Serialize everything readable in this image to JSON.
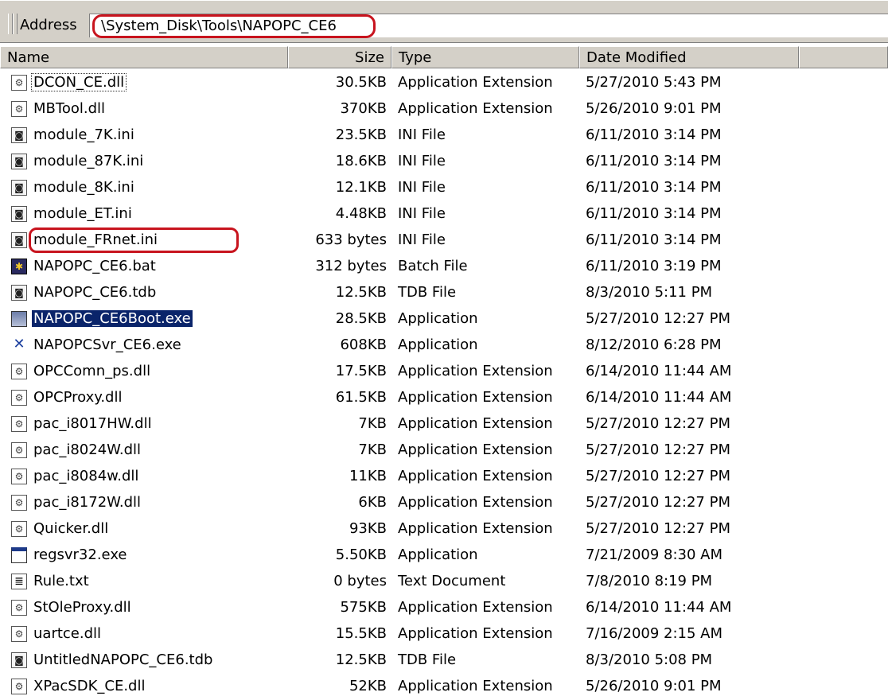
{
  "address_bar": {
    "label": "Address",
    "path": "\\System_Disk\\Tools\\NAPOPC_CE6"
  },
  "columns": {
    "name": "Name",
    "size": "Size",
    "type": "Type",
    "date": "Date Modified"
  },
  "colors": {
    "highlight_oval": "#c8141e",
    "selection": "#0a246a"
  },
  "files": [
    {
      "icon": "dll-file-icon",
      "name": "DCON_CE.dll",
      "size": "30.5KB",
      "type": "Application Extension",
      "date": "5/27/2010 5:43 PM"
    },
    {
      "icon": "dll-file-icon",
      "name": "MBTool.dll",
      "size": "370KB",
      "type": "Application Extension",
      "date": "5/26/2010 9:01 PM"
    },
    {
      "icon": "ini-file-icon",
      "name": "module_7K.ini",
      "size": "23.5KB",
      "type": "INI File",
      "date": "6/11/2010 3:14 PM"
    },
    {
      "icon": "ini-file-icon",
      "name": "module_87K.ini",
      "size": "18.6KB",
      "type": "INI File",
      "date": "6/11/2010 3:14 PM"
    },
    {
      "icon": "ini-file-icon",
      "name": "module_8K.ini",
      "size": "12.1KB",
      "type": "INI File",
      "date": "6/11/2010 3:14 PM"
    },
    {
      "icon": "ini-file-icon",
      "name": "module_ET.ini",
      "size": "4.48KB",
      "type": "INI File",
      "date": "6/11/2010 3:14 PM"
    },
    {
      "icon": "ini-file-icon",
      "name": "module_FRnet.ini",
      "size": "633 bytes",
      "type": "INI File",
      "date": "6/11/2010 3:14 PM"
    },
    {
      "icon": "batch-file-icon",
      "name": "NAPOPC_CE6.bat",
      "size": "312 bytes",
      "type": "Batch File",
      "date": "6/11/2010 3:19 PM"
    },
    {
      "icon": "ini-file-icon",
      "name": "NAPOPC_CE6.tdb",
      "size": "12.5KB",
      "type": "TDB File",
      "date": "8/3/2010 5:11 PM"
    },
    {
      "icon": "application-icon",
      "name": "NAPOPC_CE6Boot.exe",
      "size": "28.5KB",
      "type": "Application",
      "date": "5/27/2010 12:27 PM"
    },
    {
      "icon": "server-app-icon",
      "name": "NAPOPCSvr_CE6.exe",
      "size": "608KB",
      "type": "Application",
      "date": "8/12/2010 6:28 PM"
    },
    {
      "icon": "dll-file-icon",
      "name": "OPCComn_ps.dll",
      "size": "17.5KB",
      "type": "Application Extension",
      "date": "6/14/2010 11:44 AM"
    },
    {
      "icon": "dll-file-icon",
      "name": "OPCProxy.dll",
      "size": "61.5KB",
      "type": "Application Extension",
      "date": "6/14/2010 11:44 AM"
    },
    {
      "icon": "dll-file-icon",
      "name": "pac_i8017HW.dll",
      "size": "7KB",
      "type": "Application Extension",
      "date": "5/27/2010 12:27 PM"
    },
    {
      "icon": "dll-file-icon",
      "name": "pac_i8024W.dll",
      "size": "7KB",
      "type": "Application Extension",
      "date": "5/27/2010 12:27 PM"
    },
    {
      "icon": "dll-file-icon",
      "name": "pac_i8084w.dll",
      "size": "11KB",
      "type": "Application Extension",
      "date": "5/27/2010 12:27 PM"
    },
    {
      "icon": "dll-file-icon",
      "name": "pac_i8172W.dll",
      "size": "6KB",
      "type": "Application Extension",
      "date": "5/27/2010 12:27 PM"
    },
    {
      "icon": "dll-file-icon",
      "name": "Quicker.dll",
      "size": "93KB",
      "type": "Application Extension",
      "date": "5/27/2010 12:27 PM"
    },
    {
      "icon": "window-app-icon",
      "name": "regsvr32.exe",
      "size": "5.50KB",
      "type": "Application",
      "date": "7/21/2009 8:30 AM"
    },
    {
      "icon": "text-file-icon",
      "name": "Rule.txt",
      "size": "0 bytes",
      "type": "Text Document",
      "date": "7/8/2010 8:19 PM"
    },
    {
      "icon": "dll-file-icon",
      "name": "StOleProxy.dll",
      "size": "575KB",
      "type": "Application Extension",
      "date": "6/14/2010 11:44 AM"
    },
    {
      "icon": "dll-file-icon",
      "name": "uartce.dll",
      "size": "15.5KB",
      "type": "Application Extension",
      "date": "7/16/2009 2:15 AM"
    },
    {
      "icon": "ini-file-icon",
      "name": "UntitledNAPOPC_CE6.tdb",
      "size": "12.5KB",
      "type": "TDB File",
      "date": "8/3/2010 5:08 PM"
    },
    {
      "icon": "dll-file-icon",
      "name": "XPacSDK_CE.dll",
      "size": "52KB",
      "type": "Application Extension",
      "date": "5/26/2010 9:01 PM"
    }
  ]
}
